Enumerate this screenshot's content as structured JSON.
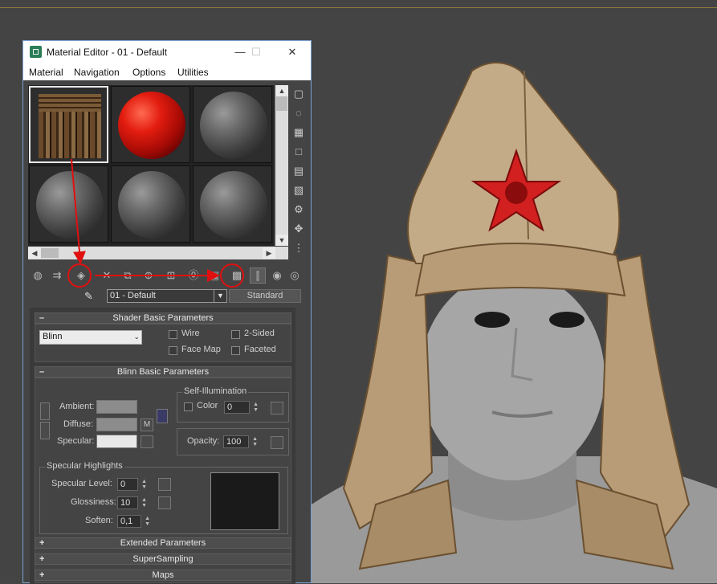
{
  "window": {
    "title": "Material Editor - 01 - Default",
    "minimize": "—",
    "maximize": "☐",
    "close": "✕"
  },
  "menu": [
    "Material",
    "Navigation",
    "Options",
    "Utilities"
  ],
  "slots": [
    {
      "kind": "cube-textured"
    },
    {
      "kind": "sphere-red"
    },
    {
      "kind": "sphere-gray"
    },
    {
      "kind": "sphere-gray"
    },
    {
      "kind": "sphere-gray"
    },
    {
      "kind": "sphere-gray"
    }
  ],
  "material": {
    "name": "01 - Default",
    "type_button": "Standard"
  },
  "shader_basic": {
    "header": "Shader Basic Parameters",
    "collapse_sign": "–",
    "shader": "Blinn",
    "wire": "Wire",
    "two_sided": "2-Sided",
    "face_map": "Face Map",
    "faceted": "Faceted"
  },
  "blinn_basic": {
    "header": "Blinn Basic Parameters",
    "collapse_sign": "–",
    "ambient_label": "Ambient:",
    "diffuse_label": "Diffuse:",
    "specular_label": "Specular:",
    "map_button": "M",
    "self_illum_title": "Self-Illumination",
    "color_label": "Color",
    "color_value": "0",
    "opacity_label": "Opacity:",
    "opacity_value": "100",
    "ambient_color": "#8c8c8c",
    "diffuse_color": "#8c8c8c",
    "specular_color": "#e8e8e8"
  },
  "specular_highlights": {
    "title": "Specular Highlights",
    "level_label": "Specular Level:",
    "level_value": "0",
    "gloss_label": "Glossiness:",
    "gloss_value": "10",
    "soften_label": "Soften:",
    "soften_value": "0,1"
  },
  "rollouts_collapsed": [
    {
      "sign": "+",
      "label": "Extended Parameters"
    },
    {
      "sign": "+",
      "label": "SuperSampling"
    },
    {
      "sign": "+",
      "label": "Maps"
    }
  ]
}
